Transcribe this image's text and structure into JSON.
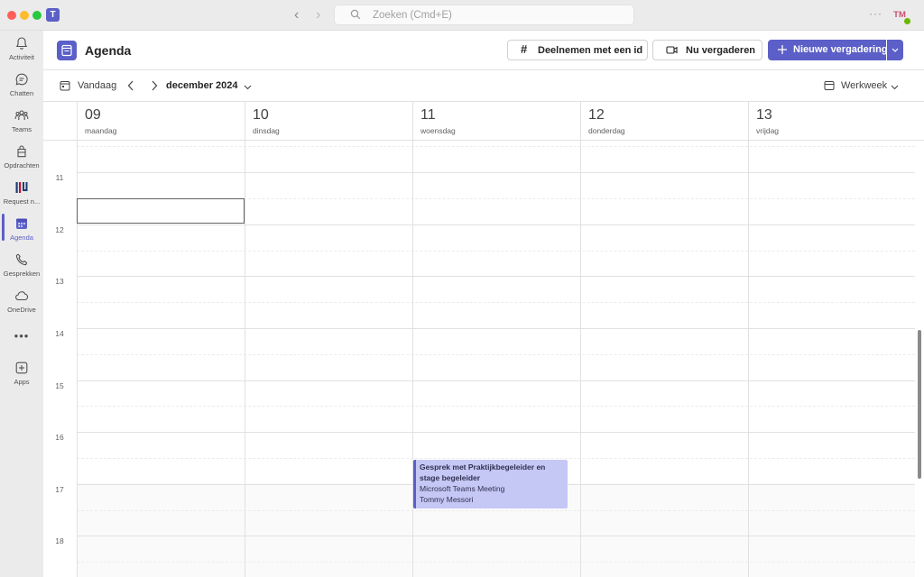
{
  "window": {
    "search_placeholder": "Zoeken (Cmd+E)",
    "user_initials": "TM",
    "colors": {
      "close": "#ff5f57",
      "minimize": "#febc2e",
      "zoom": "#28c840",
      "accent": "#5b5fc7"
    }
  },
  "rail": {
    "items": [
      {
        "label": "Activiteit",
        "icon": "bell-icon"
      },
      {
        "label": "Chatten",
        "icon": "chat-icon"
      },
      {
        "label": "Teams",
        "icon": "teams-icon"
      },
      {
        "label": "Opdrachten",
        "icon": "assignments-icon"
      },
      {
        "label": "Request n...",
        "icon": "hu-app-icon"
      },
      {
        "label": "Agenda",
        "icon": "calendar-icon"
      },
      {
        "label": "Gesprekken",
        "icon": "phone-icon"
      },
      {
        "label": "OneDrive",
        "icon": "cloud-icon"
      },
      {
        "label": "Apps",
        "icon": "add-apps-icon"
      }
    ]
  },
  "header": {
    "title": "Agenda",
    "join_label": "Deelnemen met een id",
    "meet_now_label": "Nu vergaderen",
    "new_meeting_label": "Nieuwe vergadering"
  },
  "toolbar": {
    "today_label": "Vandaag",
    "month_label": "december 2024",
    "view_label": "Werkweek"
  },
  "days": [
    {
      "num": "09",
      "name": "maandag"
    },
    {
      "num": "10",
      "name": "dinsdag"
    },
    {
      "num": "11",
      "name": "woensdag"
    },
    {
      "num": "12",
      "name": "donderdag"
    },
    {
      "num": "13",
      "name": "vrijdag"
    }
  ],
  "hours": [
    "11",
    "12",
    "13",
    "14",
    "15",
    "16",
    "17",
    "18"
  ],
  "event": {
    "title": "Gesprek met Praktijkbegeleider en stage begeleider",
    "location": "Microsoft Teams Meeting",
    "organizer": "Tommy Messori"
  }
}
